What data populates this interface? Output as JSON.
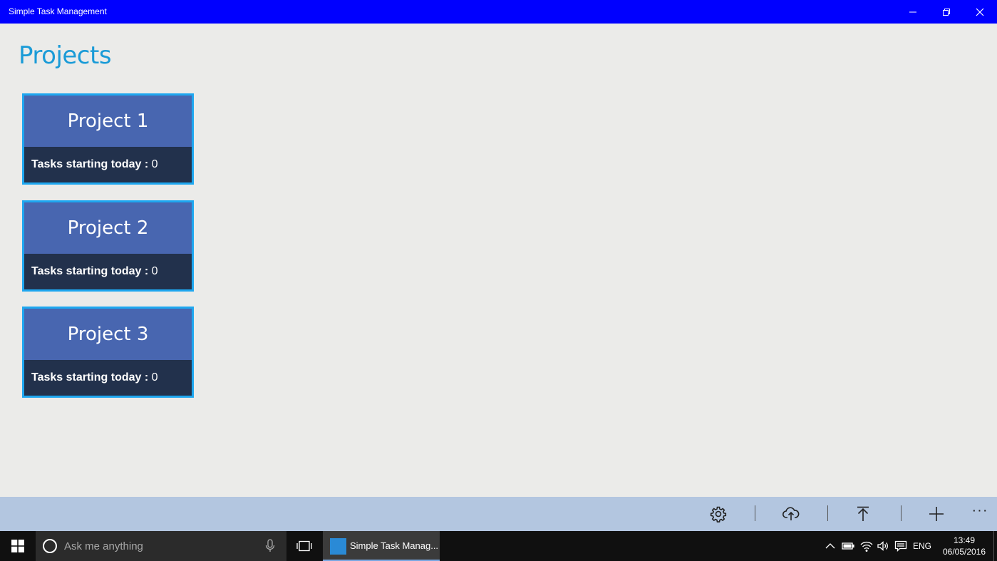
{
  "window": {
    "title": "Simple Task Management",
    "controls": [
      "minimize",
      "restore",
      "close"
    ]
  },
  "page": {
    "title": "Projects"
  },
  "projects": [
    {
      "name": "Project 1",
      "tasks_label": "Tasks starting today :",
      "tasks_count": "0"
    },
    {
      "name": "Project 2",
      "tasks_label": "Tasks starting today :",
      "tasks_count": "0"
    },
    {
      "name": "Project 3",
      "tasks_label": "Tasks starting today :",
      "tasks_count": "0"
    }
  ],
  "command_bar": {
    "buttons": [
      "gear-icon",
      "cloud-upload-icon",
      "upload-icon",
      "add-icon"
    ],
    "more": "···"
  },
  "taskbar": {
    "search_placeholder": "Ask me anything",
    "active_app": "Simple Task Manag...",
    "language": "ENG",
    "time": "13:49",
    "date": "06/05/2016"
  },
  "colors": {
    "titlebar": "#0000ff",
    "page_background": "#ebebe9",
    "accent_title": "#1a9bd7",
    "tile_header": "#4866b0",
    "tile_footer": "#22314c",
    "tile_border": "#1ea7f0",
    "command_bar": "#b3c6e0",
    "taskbar": "#101010"
  }
}
